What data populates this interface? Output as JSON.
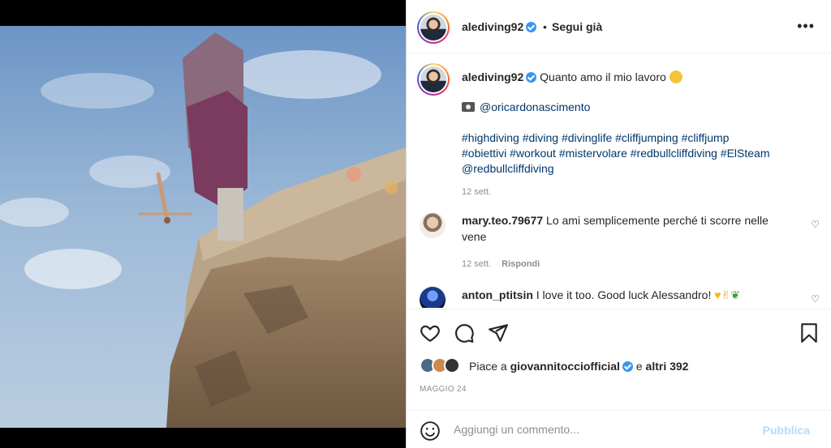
{
  "post": {
    "username": "alediving92",
    "follow_status": "Segui già",
    "separator": "•"
  },
  "caption": {
    "username": "alediving92",
    "text": "Quanto amo il mio lavoro",
    "photo_credit": "@oricardonascimento",
    "hashtags_line1": "#highdiving #diving #divinglife #cliffjumping #cliffjump",
    "hashtags_line2": "#obiettivi #workout #mistervolare #redbullcliffdiving #ElSteam",
    "mention": "@redbullcliffdiving",
    "time": "12 sett."
  },
  "comments": [
    {
      "username": "mary.teo.79677",
      "text": "Lo ami semplicemente perché ti scorre nelle vene",
      "time": "12 sett.",
      "reply_label": "Rispondi"
    },
    {
      "username": "anton_ptitsin",
      "text": "I love it too. Good luck Alessandro!"
    }
  ],
  "likes": {
    "prefix": "Piace a",
    "user": "giovannitocciofficial",
    "conj": "e",
    "others": "altri 392"
  },
  "date": "MAGGIO 24",
  "add_comment": {
    "placeholder": "Aggiungi un commento...",
    "publish_label": "Pubblica"
  },
  "colors": {
    "link": "#00376b",
    "verified": "#3897f0",
    "publish_disabled": "#b3dbff",
    "meta": "#8e8e8e"
  },
  "icons": [
    "verified-badge-icon",
    "more-options-icon",
    "camera-emoji-icon",
    "smile-emoji-icon",
    "heart-icon",
    "comment-icon",
    "share-icon",
    "bookmark-icon",
    "emoji-picker-icon",
    "yellow-heart-emoji-icon",
    "ok-hand-emoji-icon",
    "herb-emoji-icon"
  ]
}
